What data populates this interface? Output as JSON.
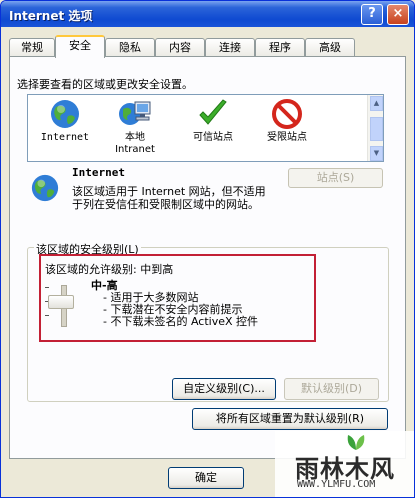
{
  "window": {
    "title": "Internet 选项",
    "help_label": "?",
    "close_label": "×"
  },
  "tabs": [
    {
      "label": "常规"
    },
    {
      "label": "安全"
    },
    {
      "label": "隐私"
    },
    {
      "label": "内容"
    },
    {
      "label": "连接"
    },
    {
      "label": "程序"
    },
    {
      "label": "高级"
    }
  ],
  "active_tab": "安全",
  "zones_prompt": "选择要查看的区域或更改安全设置。",
  "zones": [
    {
      "label": "Internet",
      "icon": "globe-icon"
    },
    {
      "label": "本地\nIntranet",
      "icon": "local-intranet-icon"
    },
    {
      "label": "可信站点",
      "icon": "checkmark-icon"
    },
    {
      "label": "受限站点",
      "icon": "prohibited-icon"
    }
  ],
  "selected_zone": {
    "name": "Internet",
    "description": "该区域适用于 Internet 网站，但不适用于列在受信任和受限制区域中的网站。",
    "sites_button": "站点(S)"
  },
  "security_level": {
    "group_label": "该区域的安全级别(L)",
    "allowed_level": "该区域的允许级别: 中到高",
    "level_name": "中-高",
    "bullets": [
      "- 适用于大多数网站",
      "- 下载潜在不安全内容前提示",
      "- 不下载未签名的 ActiveX 控件"
    ],
    "custom_button": "自定义级别(C)...",
    "default_button": "默认级别(D)"
  },
  "reset_all_button": "将所有区域重置为默认级别(R)",
  "ok_button": "确定",
  "watermark": {
    "text": "雨林木风",
    "url": "WWW.YLMFU.COM"
  },
  "colors": {
    "highlight_box": "#c32035",
    "titlebar": "#0f4ad1"
  }
}
